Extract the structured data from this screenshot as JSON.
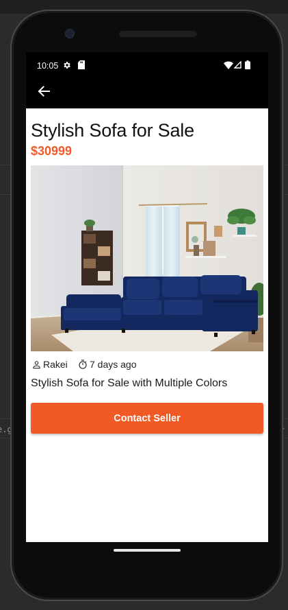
{
  "ide_backdrop": {
    "fragment_text": "e.g.",
    "chevron": "›"
  },
  "status_bar": {
    "time": "10:05",
    "icons": [
      "settings-icon",
      "sd-card-icon",
      "wifi-icon",
      "cellular-signal-icon",
      "battery-icon"
    ]
  },
  "app_bar": {
    "back_icon": "arrow-back-icon"
  },
  "listing": {
    "title": "Stylish Sofa for Sale",
    "price": "$30999",
    "image_description": "navy sectional sofa in living room",
    "seller_icon": "person-icon",
    "seller": "Rakei",
    "time_icon": "timer-icon",
    "posted": "7 days ago",
    "description": "Stylish Sofa for Sale with Multiple Colors"
  },
  "actions": {
    "contact_label": "Contact Seller"
  },
  "colors": {
    "accent": "#f25a25",
    "price": "#f05a28",
    "sofa": "#13285e"
  }
}
